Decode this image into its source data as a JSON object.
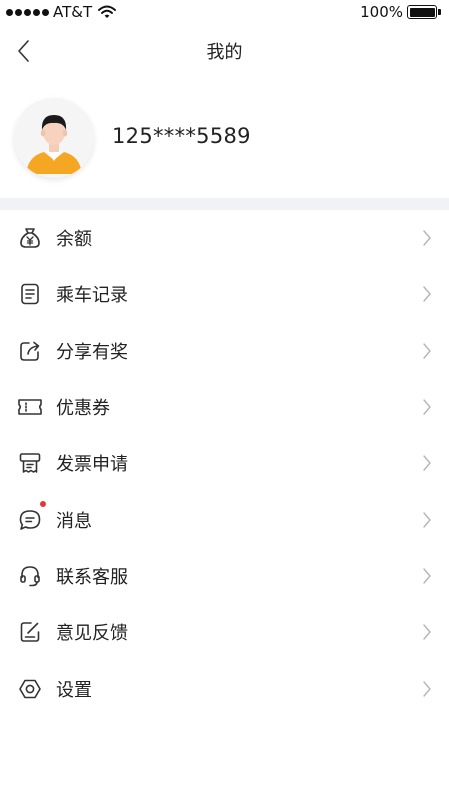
{
  "status_bar": {
    "carrier": "AT&T",
    "battery_percent": "100%",
    "signal_bars": 5,
    "battery_level": 1.0
  },
  "nav": {
    "title": "我的",
    "back_icon": "chevron-left-icon"
  },
  "profile": {
    "phone": "125****5589",
    "avatar_icon": "user-avatar"
  },
  "menu": {
    "items": [
      {
        "label": "余额",
        "icon": "wallet-icon"
      },
      {
        "label": "乘车记录",
        "icon": "document-icon"
      },
      {
        "label": "分享有奖",
        "icon": "share-icon"
      },
      {
        "label": "优惠券",
        "icon": "coupon-icon"
      },
      {
        "label": "发票申请",
        "icon": "invoice-icon"
      },
      {
        "label": "消息",
        "icon": "message-icon",
        "has_unread": true
      },
      {
        "label": "联系客服",
        "icon": "headset-icon"
      },
      {
        "label": "意见反馈",
        "icon": "feedback-icon"
      },
      {
        "label": "设置",
        "icon": "settings-icon"
      }
    ]
  },
  "colors": {
    "accent_dot": "#e8333a",
    "section_bg": "#f1f2f5",
    "avatar_shirt": "#f5a623"
  }
}
